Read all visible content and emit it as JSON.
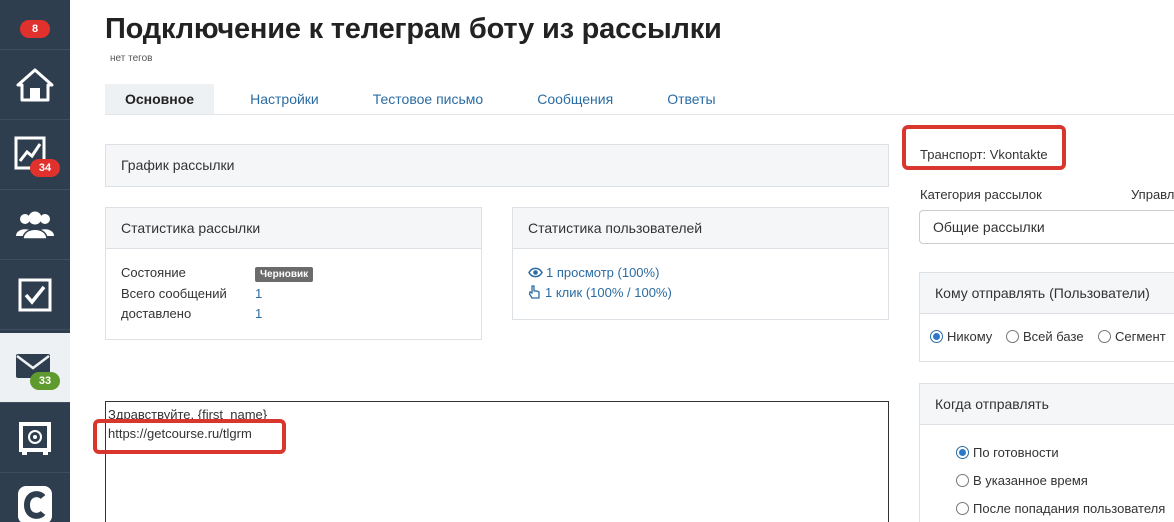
{
  "sidebar": {
    "top_badge": "8",
    "items": [
      {
        "icon": "home-icon",
        "badge": ""
      },
      {
        "icon": "sales-chart-icon",
        "badge": "34"
      },
      {
        "icon": "users-icon",
        "badge": ""
      },
      {
        "icon": "tasks-checkbox-icon",
        "badge": ""
      },
      {
        "icon": "mail-icon",
        "badge": "33"
      },
      {
        "icon": "safe-icon",
        "badge": ""
      },
      {
        "icon": "getcourse-logo-icon",
        "badge": ""
      }
    ]
  },
  "header": {
    "title": "Подключение к телеграм боту из рассылки",
    "tags": "нет тегов"
  },
  "tabs": [
    {
      "label": "Основное",
      "active": true
    },
    {
      "label": "Настройки",
      "active": false
    },
    {
      "label": "Тестовое письмо",
      "active": false
    },
    {
      "label": "Сообщения",
      "active": false
    },
    {
      "label": "Ответы",
      "active": false
    }
  ],
  "schedule_panel": {
    "title": "График рассылки"
  },
  "mailing_stats": {
    "title": "Статистика рассылки",
    "rows": [
      {
        "label": "Состояние",
        "value": "Черновик"
      },
      {
        "label": "Всего сообщений",
        "value": "1"
      },
      {
        "label": "доставлено",
        "value": "1"
      }
    ]
  },
  "user_stats": {
    "title": "Статистика пользователей",
    "views": "1 просмотр (100%)",
    "clicks": "1 клик (100% / 100%)"
  },
  "editor": {
    "line1": "Здравствуйте, {first_name}",
    "line2": "https://getcourse.ru/tlgrm"
  },
  "right": {
    "transport": "Транспорт: Vkontakte",
    "category_label": "Категория рассылок",
    "manage_link": "Управл",
    "category_value": "Общие рассылки",
    "recipients_title": "Кому отправлять (Пользователи)",
    "recipients_options": [
      "Никому",
      "Всей базе",
      "Сегмент"
    ],
    "recipients_selected": "Никому",
    "when_title": "Когда отправлять",
    "when_options": [
      "По готовности",
      "В указанное время",
      "После попадания пользователя"
    ],
    "when_selected": "По готовности"
  },
  "colors": {
    "sidebar": "#2f3e4e",
    "link": "#2b6ca3",
    "highlight": "#d9362d",
    "badge_red": "#e0312d",
    "badge_green": "#5e9a2e"
  }
}
